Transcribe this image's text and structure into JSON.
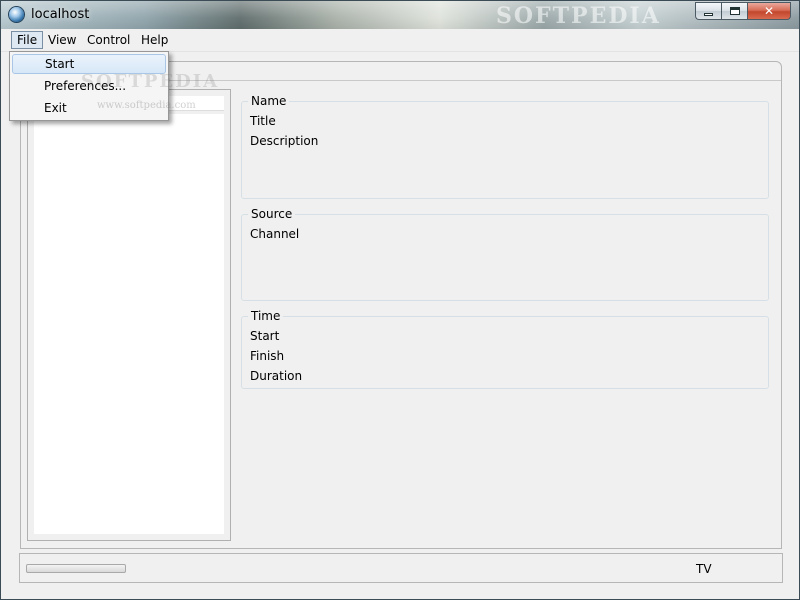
{
  "window": {
    "title": "localhost",
    "watermark": "SOFTPEDIA",
    "controls": {
      "minimize_icon": "minimize-icon",
      "maximize_icon": "maximize-icon",
      "close_glyph": "✕"
    }
  },
  "menubar": {
    "items": [
      {
        "label": "File"
      },
      {
        "label": "View"
      },
      {
        "label": "Control"
      },
      {
        "label": "Help"
      }
    ]
  },
  "file_menu": {
    "items": [
      {
        "label": "Start"
      },
      {
        "label": "Preferences..."
      },
      {
        "label": "Exit"
      }
    ],
    "watermark": "SOFTPEDIA",
    "watermark_url": "www.softpedia.com"
  },
  "details": {
    "name_group": {
      "legend": "Name",
      "rows": [
        "Title",
        "Description"
      ]
    },
    "source_group": {
      "legend": "Source",
      "rows": [
        "Channel"
      ]
    },
    "time_group": {
      "legend": "Time",
      "rows": [
        "Start",
        "Finish",
        "Duration"
      ]
    }
  },
  "statusbar": {
    "progress_fraction": 0.0,
    "label": "TV"
  },
  "colors": {
    "menu_highlight": "#dde8f3",
    "progress_fill": "#4cc04c",
    "close_button": "#c2472d"
  }
}
